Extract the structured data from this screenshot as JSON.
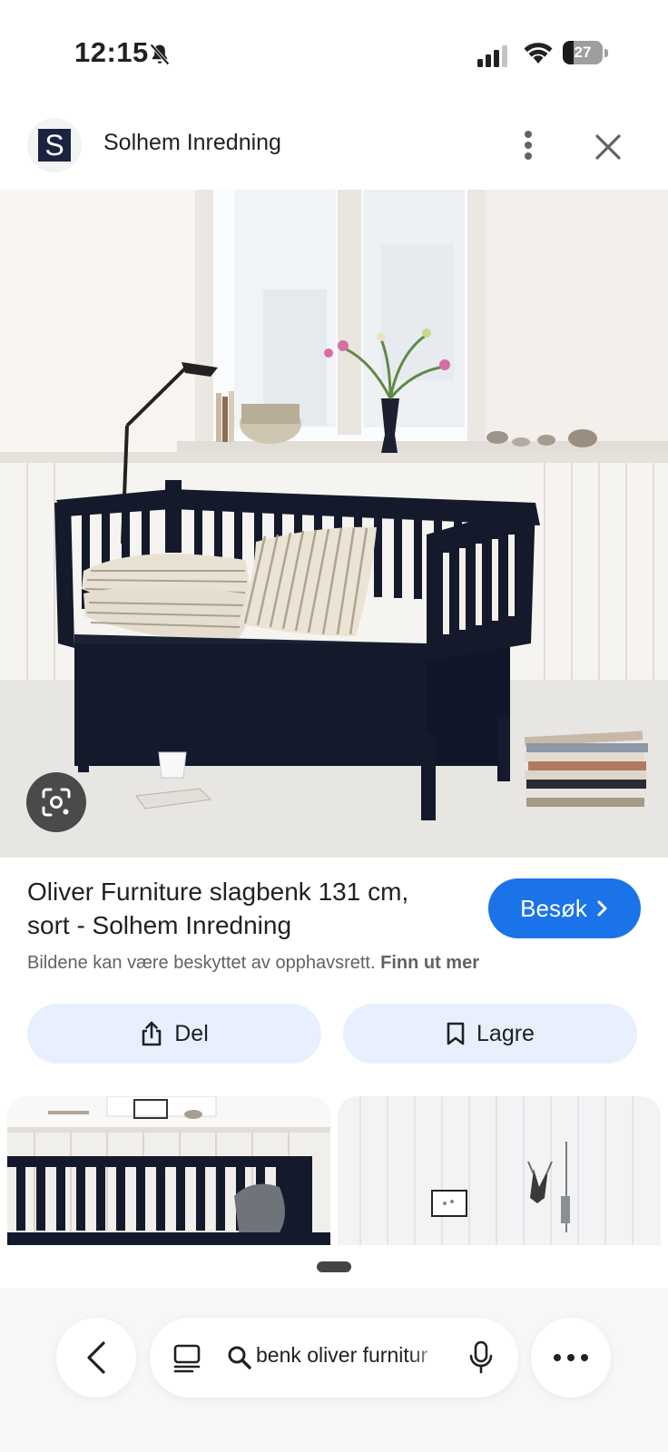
{
  "status_bar": {
    "time": "12:15",
    "battery": "27",
    "battery_level": 0.27,
    "icons": [
      "bell-muted-icon",
      "signal-icon",
      "wifi-icon",
      "battery-icon"
    ]
  },
  "header": {
    "logo_letter": "S",
    "site_name": "Solhem Inredning",
    "icons": [
      "more-vert-icon",
      "close-icon"
    ]
  },
  "result": {
    "title": "Oliver Furniture slagbenk 131 cm, sort - Solhem Inredning",
    "visit_label": "Besøk",
    "copyright_text": "Bildene kan være beskyttet av opphavsrett.",
    "learn_more": "Finn ut mer"
  },
  "actions": {
    "share_label": "Del",
    "save_label": "Lagre"
  },
  "search": {
    "query": "benk oliver furnitur"
  },
  "colors": {
    "accent": "#1a73e8",
    "chip_bg": "#e8f0fe",
    "bench": "#141a2b"
  }
}
